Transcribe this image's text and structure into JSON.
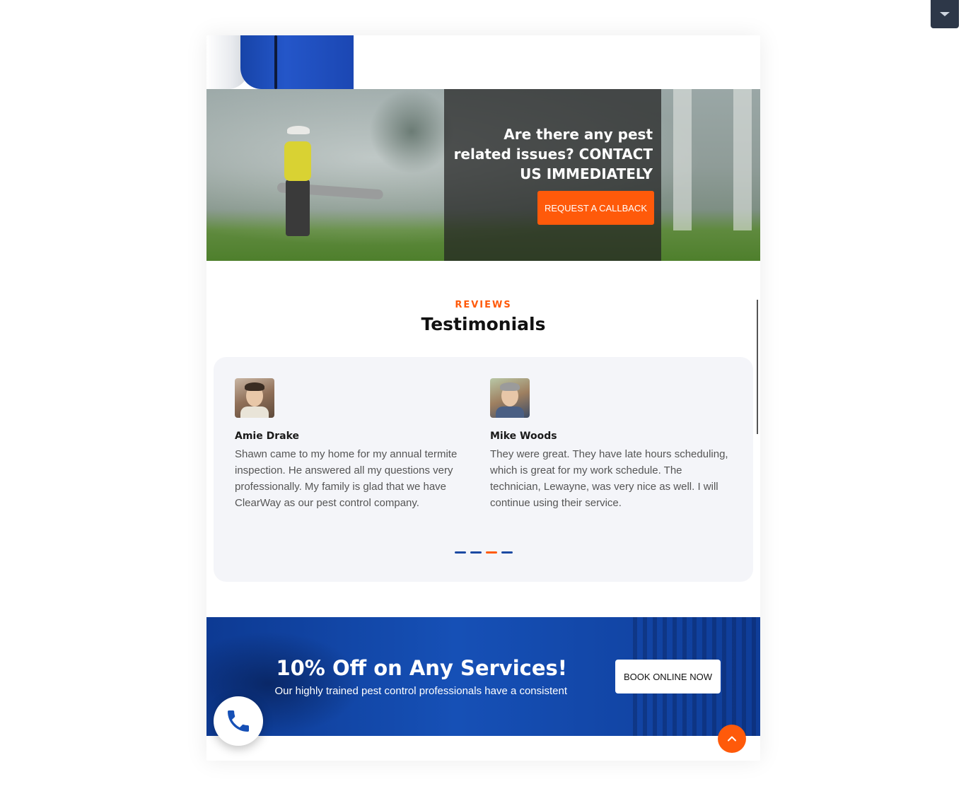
{
  "colors": {
    "accent": "#ff5a0a",
    "brand_blue": "#1650b6",
    "card_bg": "#f4f5f9"
  },
  "icons": {
    "top_toggle": "caret-down-icon",
    "phone": "phone-icon",
    "scroll_top": "chevron-up-icon"
  },
  "cta": {
    "title": "Are there any pest related issues? CONTACT US IMMEDIATELY",
    "button_label": "REQUEST A CALLBACK"
  },
  "testimonials": {
    "label": "REVIEWS",
    "title": "Testimonials",
    "reviews": [
      {
        "name": "Amie Drake",
        "text": "Shawn came to my home for my annual termite inspection. He answered all my questions very professionally. My family is glad that we have ClearWay as our pest control company."
      },
      {
        "name": "Mike Woods",
        "text": "They were great. They have late hours scheduling, which is great for my work schedule. The technician, Lewayne, was very nice as well. I will continue using their service."
      }
    ],
    "pagination": {
      "total": 4,
      "active_index": 2
    }
  },
  "promo": {
    "title": "10% Off on Any Services!",
    "subtitle": "Our highly trained pest control professionals have a consistent",
    "button_label": "BOOK ONLINE NOW"
  }
}
